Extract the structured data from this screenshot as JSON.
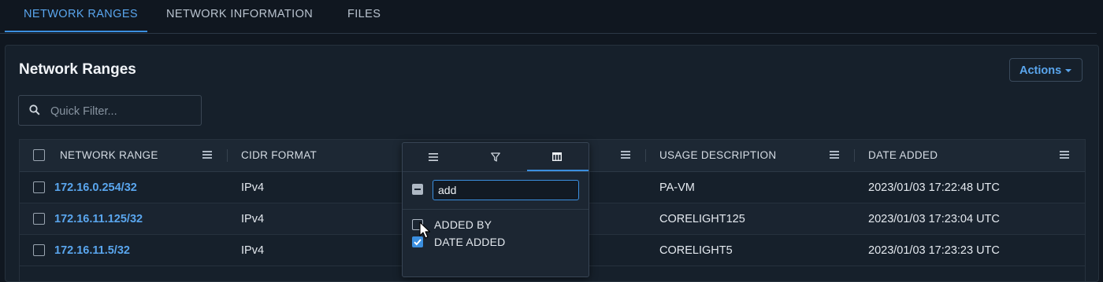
{
  "tabs": [
    {
      "label": "NETWORK RANGES",
      "active": true
    },
    {
      "label": "NETWORK INFORMATION",
      "active": false
    },
    {
      "label": "FILES",
      "active": false
    }
  ],
  "panel": {
    "title": "Network Ranges",
    "actions_label": "Actions"
  },
  "search": {
    "placeholder": "Quick Filter..."
  },
  "grid": {
    "columns": [
      "NETWORK RANGE",
      "CIDR FORMAT",
      "USAGE DESCRIPTION",
      "DATE ADDED"
    ],
    "rows": [
      {
        "range": "172.16.0.254/32",
        "cidr": "IPv4",
        "usage": "PA-VM",
        "date": "2023/01/03 17:22:48 UTC"
      },
      {
        "range": "172.16.11.125/32",
        "cidr": "IPv4",
        "usage": "CORELIGHT125",
        "date": "2023/01/03 17:23:04 UTC"
      },
      {
        "range": "172.16.11.5/32",
        "cidr": "IPv4",
        "usage": "CORELIGHT5",
        "date": "2023/01/03 17:23:23 UTC"
      }
    ]
  },
  "column_menu": {
    "active_tab": "columns-tab",
    "search_value": "add",
    "items": [
      {
        "label": "ADDED BY",
        "checked": false
      },
      {
        "label": "DATE ADDED",
        "checked": true
      }
    ]
  },
  "colors": {
    "accent": "#3b8fe0",
    "link": "#5aa6ee",
    "background": "#101720",
    "panel": "#16202b"
  }
}
